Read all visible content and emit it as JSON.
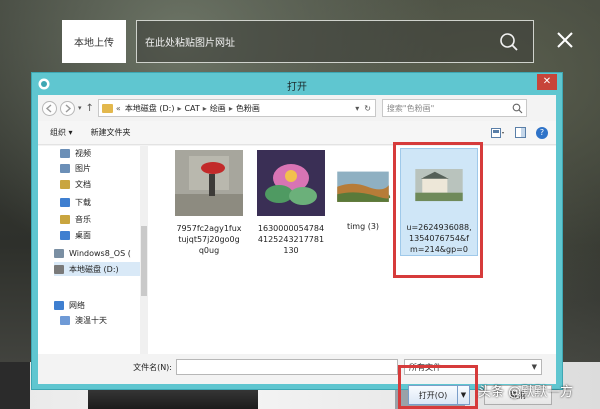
{
  "topbar": {
    "upload_label": "本地上传",
    "url_placeholder": "在此处粘贴图片网址"
  },
  "dialog": {
    "title": "打开",
    "breadcrumb": [
      "本地磁盘 (D:)",
      "CAT",
      "绘画",
      "色粉画"
    ],
    "search_placeholder": "搜索\"色粉画\"",
    "toolbar": {
      "organize": "组织 ▾",
      "new_folder": "新建文件夹"
    },
    "sidebar": [
      {
        "label": "视频",
        "color": "#6b8fb7"
      },
      {
        "label": "图片",
        "color": "#6b8fb7"
      },
      {
        "label": "文档",
        "color": "#c9a53f"
      },
      {
        "label": "下载",
        "color": "#3f7fd0"
      },
      {
        "label": "音乐",
        "color": "#c9a53f"
      },
      {
        "label": "桌面",
        "color": "#3f7fd0"
      },
      {
        "label": "Windows8_OS (",
        "color": "#7a8fa3"
      },
      {
        "label": "本地磁盘 (D:)",
        "color": "#7a7a7a"
      },
      {
        "label": "网络",
        "color": "#3f7fd0"
      },
      {
        "label": "澳温十天",
        "color": "#6f9ad6"
      }
    ],
    "files": [
      {
        "name": "7957fc2agy1fux tujqt57j20go0g q0ug"
      },
      {
        "name": "1630000054784 4125243217781 130"
      },
      {
        "name": "timg (3)"
      },
      {
        "name": "u=2624936088, 1354076754&f m=214&gp=0"
      }
    ],
    "filename_label": "文件名(N):",
    "filetype_value": "所有文件",
    "open_label": "打开(O)",
    "cancel_label": "取消"
  },
  "watermark": "头条 @默默一方"
}
